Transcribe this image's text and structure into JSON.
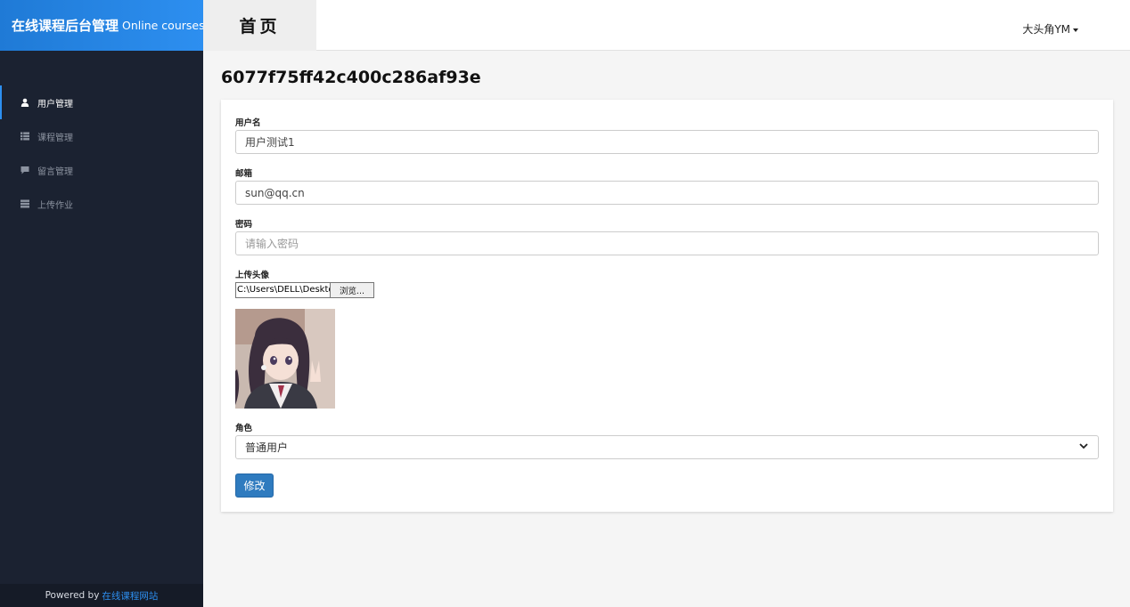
{
  "brand": {
    "main": "在线课程后台管理",
    "sub": "Online courses"
  },
  "sidebar": {
    "items": [
      {
        "label": "用户管理",
        "icon": "user-icon"
      },
      {
        "label": "课程管理",
        "icon": "list-icon"
      },
      {
        "label": "留言管理",
        "icon": "comment-icon"
      },
      {
        "label": "上传作业",
        "icon": "stack-icon"
      }
    ],
    "footer": {
      "text": "Powered by",
      "link": "在线课程网站"
    }
  },
  "header": {
    "tab": "首页",
    "user": "大头角YM"
  },
  "main": {
    "title": "6077f75ff42c400c286af93e",
    "form": {
      "username_label": "用户名",
      "username_value": "用户测试1",
      "email_label": "邮箱",
      "email_value": "sun@qq.cn",
      "password_label": "密码",
      "password_placeholder": "请输入密码",
      "avatar_label": "上传头像",
      "file_path": "C:\\Users\\DELL\\Desktop",
      "file_button": "浏览...",
      "role_label": "角色",
      "role_value": "普通用户",
      "submit_label": "修改"
    }
  },
  "colors": {
    "accent": "#2d8ff0",
    "sidebar": "#1b2231",
    "button": "#2f7bbf"
  }
}
